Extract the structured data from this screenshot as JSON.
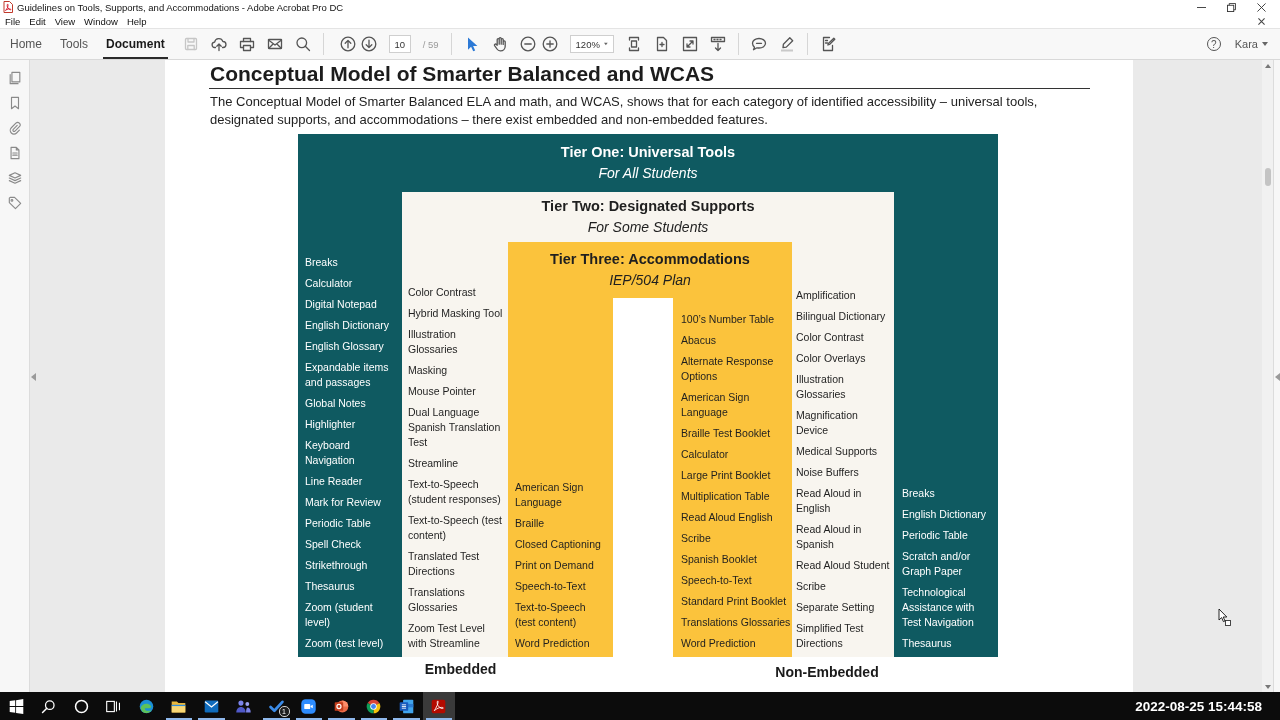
{
  "window": {
    "title": "Guidelines on Tools, Supports, and Accommodations - Adobe Acrobat Pro DC"
  },
  "menu": [
    "File",
    "Edit",
    "View",
    "Window",
    "Help"
  ],
  "tabs": [
    {
      "label": "Home",
      "selected": false
    },
    {
      "label": "Tools",
      "selected": false
    },
    {
      "label": "Document",
      "selected": true
    }
  ],
  "toolbar": {
    "file_actions": [
      {
        "kind": "save",
        "disabled": true
      },
      {
        "kind": "upload",
        "disabled": false
      },
      {
        "kind": "print",
        "disabled": false
      },
      {
        "kind": "email",
        "disabled": false
      },
      {
        "kind": "search",
        "disabled": false
      }
    ],
    "page_nav": [
      {
        "kind": "previous"
      },
      {
        "kind": "next"
      }
    ],
    "page": {
      "value": "10",
      "total": "/ 59"
    },
    "modes": [
      {
        "kind": "select",
        "selected": true
      },
      {
        "kind": "hand",
        "selected": false
      }
    ],
    "zoom_actions": [
      {
        "kind": "zoom-out"
      },
      {
        "kind": "zoom-in"
      }
    ],
    "zoom": {
      "value": "120%"
    },
    "view_actions": [
      {
        "kind": "fit-width"
      },
      {
        "kind": "fit-page"
      },
      {
        "kind": "full-screen"
      },
      {
        "kind": "scroll-mode"
      }
    ],
    "annotate_actions": [
      {
        "kind": "comment"
      },
      {
        "kind": "highlight"
      }
    ],
    "sign_actions": [
      {
        "kind": "fill-sign"
      }
    ],
    "account": {
      "help": "?",
      "user": "Kara"
    }
  },
  "left_panel": [
    {
      "kind": "pages"
    },
    {
      "kind": "bookmarks"
    },
    {
      "kind": "attachments"
    },
    {
      "kind": "document"
    },
    {
      "kind": "layers"
    },
    {
      "kind": "tags"
    }
  ],
  "document": {
    "heading": "Conceptual Model of Smarter Balanced and WCAS",
    "paragraph": "The Conceptual Model of Smarter Balanced ELA and math, and WCAS, shows that for each category of identified accessibility – universal tools, designated supports, and accommodations – there exist embedded and non-embedded features.",
    "diagram": {
      "tiers": [
        {
          "title": "Tier One: Universal Tools",
          "subtitle": "For All Students",
          "color": "#0f5a61",
          "embedded": [
            "Breaks",
            "Calculator",
            "Digital Notepad",
            "English Dictionary",
            "English Glossary",
            "Expandable items and passages",
            "Global Notes",
            "Highlighter",
            "Keyboard Navigation",
            "Line Reader",
            "Mark for Review",
            "Periodic Table",
            "Spell Check",
            "Strikethrough",
            "Thesaurus",
            "Zoom (student level)",
            "Zoom (test level)"
          ],
          "non_embedded": [
            "Breaks",
            "English Dictionary",
            "Periodic Table",
            "Scratch and/or Graph Paper",
            "Technological Assistance with Test Navigation",
            "Thesaurus"
          ]
        },
        {
          "title": "Tier Two: Designated Supports",
          "subtitle": "For Some Students",
          "color": "#f8f5ef",
          "embedded": [
            "Color Contrast",
            "Hybrid Masking Tool",
            "Illustration Glossaries",
            "Masking",
            "Mouse Pointer",
            "Dual Language Spanish Translation Test",
            "Streamline",
            "Text-to-Speech (student responses)",
            "Text-to-Speech (test content)",
            "Translated Test Directions",
            "Translations Glossaries",
            "Zoom Test Level with Streamline"
          ],
          "non_embedded": [
            "Amplification",
            "Bilingual Dictionary",
            "Color Contrast",
            "Color Overlays",
            "Illustration Glossaries",
            "Magnification Device",
            "Medical Supports",
            "Noise Buffers",
            "Read Aloud in English",
            "Read Aloud in Spanish",
            "Read Aloud Student",
            "Scribe",
            "Separate Setting",
            "Simplified Test Directions"
          ]
        },
        {
          "title": "Tier Three: Accommodations",
          "subtitle": "IEP/504 Plan",
          "color": "#fbc33c",
          "embedded": [
            "American Sign Language",
            "Braille",
            "Closed Captioning",
            "Print on Demand",
            "Speech-to-Text",
            "Text-to-Speech (test content)",
            "Word Prediction"
          ],
          "non_embedded": [
            "100’s Number Table",
            "Abacus",
            "Alternate Response Options",
            "American Sign Language",
            "Braille Test Booklet",
            "Calculator",
            "Large Print Booklet",
            "Multiplication Table",
            "Read Aloud English",
            "Scribe",
            "Spanish Booklet",
            "Speech-to-Text",
            "Standard Print Booklet",
            "Translations Glossaries",
            "Word Prediction"
          ]
        }
      ],
      "group_labels": [
        "Embedded",
        "Non-Embedded"
      ]
    }
  },
  "taskbar": {
    "system": [
      {
        "kind": "start"
      },
      {
        "kind": "search"
      },
      {
        "kind": "cortana"
      },
      {
        "kind": "task-view"
      }
    ],
    "apps": [
      {
        "kind": "edge",
        "open": false,
        "selected": false
      },
      {
        "kind": "explorer",
        "open": true,
        "selected": false
      },
      {
        "kind": "outlook",
        "open": true,
        "selected": false
      },
      {
        "kind": "teams",
        "open": false,
        "selected": false
      },
      {
        "kind": "todo",
        "open": true,
        "selected": false,
        "badge": "1"
      },
      {
        "kind": "zoom",
        "open": true,
        "selected": false
      },
      {
        "kind": "powerpoint",
        "open": true,
        "selected": false
      },
      {
        "kind": "chrome",
        "open": true,
        "selected": false
      },
      {
        "kind": "word",
        "open": true,
        "selected": false
      },
      {
        "kind": "acrobat",
        "open": true,
        "selected": true
      }
    ],
    "timestamp": "2022-08-25 15:44:58"
  }
}
